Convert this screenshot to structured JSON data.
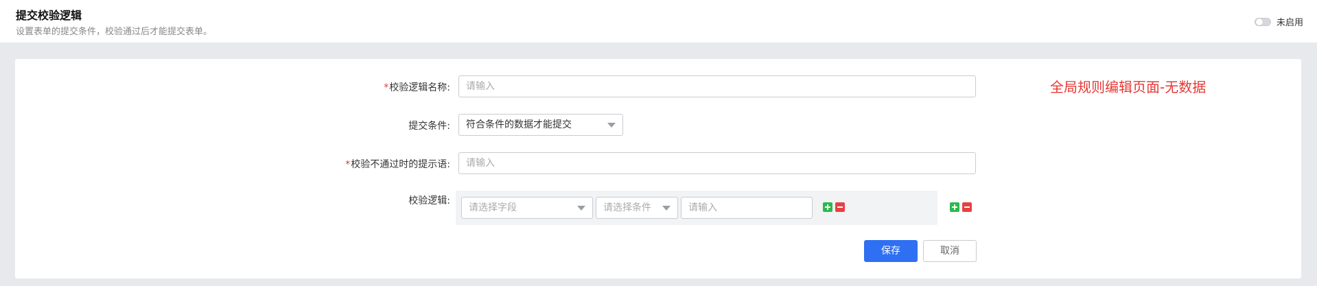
{
  "header": {
    "title": "提交校验逻辑",
    "description": "设置表单的提交条件，校验通过后才能提交表单。",
    "toggle_label": "未启用"
  },
  "form": {
    "name_field": {
      "required_mark": "*",
      "label": "校验逻辑名称:",
      "placeholder": "请输入"
    },
    "condition_field": {
      "label": "提交条件:",
      "selected": "符合条件的数据才能提交"
    },
    "message_field": {
      "required_mark": "*",
      "label": "校验不通过时的提示语:",
      "placeholder": "请输入"
    },
    "logic_field": {
      "label": "校验逻辑:",
      "field_select_placeholder": "请选择字段",
      "condition_select_placeholder": "请选择条件",
      "value_placeholder": "请输入"
    },
    "buttons": {
      "save": "保存",
      "cancel": "取消"
    }
  },
  "annotation": "全局规则编辑页面-无数据",
  "colors": {
    "primary": "#2f6ff2",
    "required": "#e53935",
    "add": "#2db84d",
    "remove": "#e84141",
    "annotation": "#e53935"
  },
  "icons": [
    "plus-icon",
    "minus-icon",
    "chevron-down-icon",
    "toggle-switch"
  ]
}
